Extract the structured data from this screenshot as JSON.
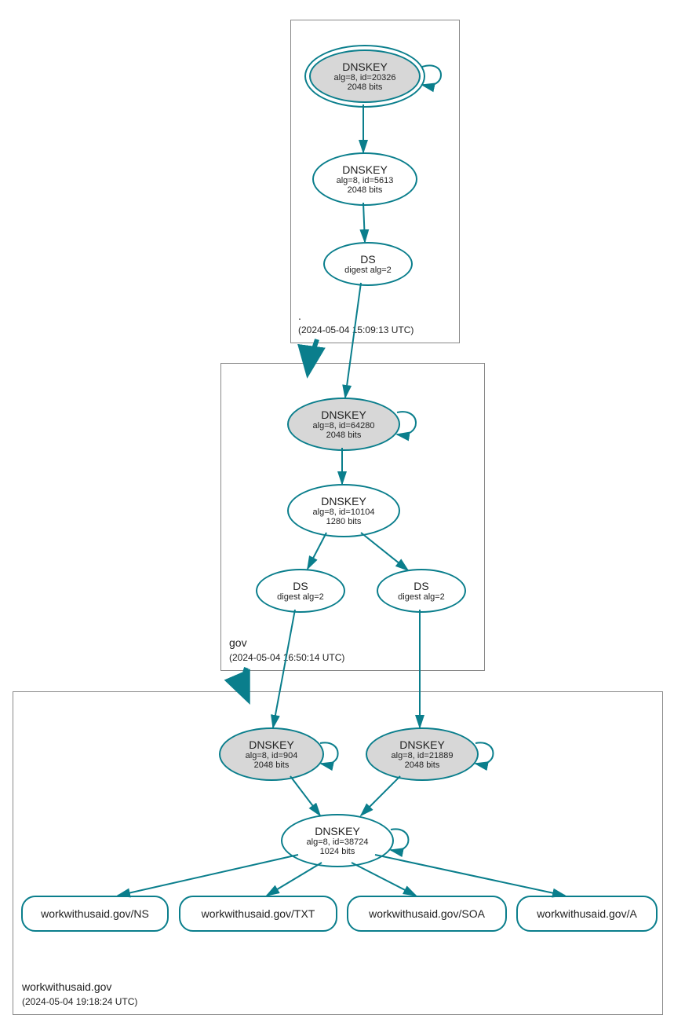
{
  "colors": {
    "stroke": "#0a7e8c",
    "fillGray": "#d7d7d7",
    "boxBorder": "#888888"
  },
  "zones": {
    "root": {
      "label": ".",
      "time": "(2024-05-04 15:09:13 UTC)"
    },
    "gov": {
      "label": "gov",
      "time": "(2024-05-04 16:50:14 UTC)"
    },
    "domain": {
      "label": "workwithusaid.gov",
      "time": "(2024-05-04 19:18:24 UTC)"
    }
  },
  "nodes": {
    "root_ksk": {
      "title": "DNSKEY",
      "line1": "alg=8, id=20326",
      "line2": "2048 bits"
    },
    "root_zsk": {
      "title": "DNSKEY",
      "line1": "alg=8, id=5613",
      "line2": "2048 bits"
    },
    "root_ds": {
      "title": "DS",
      "line1": "digest alg=2"
    },
    "gov_ksk": {
      "title": "DNSKEY",
      "line1": "alg=8, id=64280",
      "line2": "2048 bits"
    },
    "gov_zsk": {
      "title": "DNSKEY",
      "line1": "alg=8, id=10104",
      "line2": "1280 bits"
    },
    "gov_ds1": {
      "title": "DS",
      "line1": "digest alg=2"
    },
    "gov_ds2": {
      "title": "DS",
      "line1": "digest alg=2"
    },
    "dom_ksk1": {
      "title": "DNSKEY",
      "line1": "alg=8, id=904",
      "line2": "2048 bits"
    },
    "dom_ksk2": {
      "title": "DNSKEY",
      "line1": "alg=8, id=21889",
      "line2": "2048 bits"
    },
    "dom_zsk": {
      "title": "DNSKEY",
      "line1": "alg=8, id=38724",
      "line2": "1024 bits"
    }
  },
  "records": {
    "ns": "workwithusaid.gov/NS",
    "txt": "workwithusaid.gov/TXT",
    "soa": "workwithusaid.gov/SOA",
    "a": "workwithusaid.gov/A"
  }
}
